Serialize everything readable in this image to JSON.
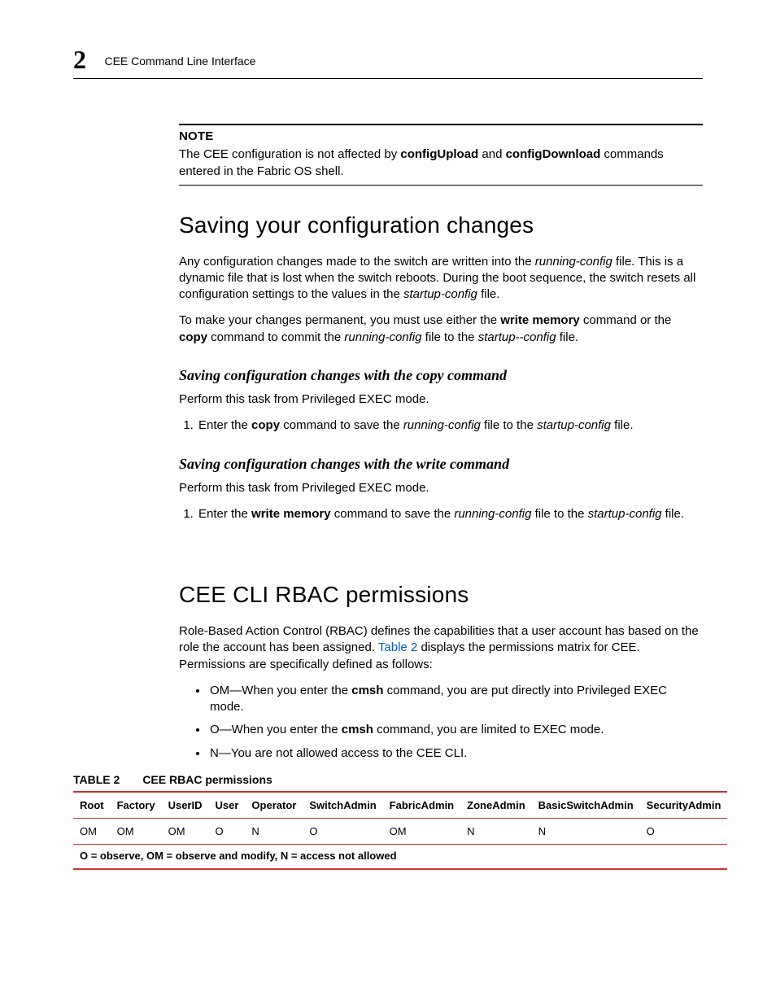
{
  "header": {
    "chapter_number": "2",
    "running_title": "CEE Command Line Interface"
  },
  "note": {
    "label": "NOTE",
    "pre": "The CEE configuration is not affected by ",
    "cmd1": "configUpload",
    "mid": " and ",
    "cmd2": "configDownload",
    "post": " commands entered in the Fabric OS shell."
  },
  "section1": {
    "title": "Saving your configuration changes",
    "p1a": "Any configuration changes made to the switch are written into the ",
    "p1b": "running-config",
    "p1c": " file. This is a dynamic file that is lost when the switch reboots. During the boot sequence, the switch resets all configuration settings to the values in the ",
    "p1d": "startup-config",
    "p1e": " file.",
    "p2a": "To make your changes permanent, you must use either the ",
    "p2b": "write memory",
    "p2c": " command or the ",
    "p2d": "copy",
    "p2e": " command to commit the ",
    "p2f": "running-config",
    "p2g": " file to the ",
    "p2h": "startup--config",
    "p2i": " file.",
    "sub1": {
      "title": "Saving configuration changes with the copy command",
      "intro": "Perform this task from Privileged EXEC mode.",
      "s1a": "Enter the ",
      "s1b": "copy",
      "s1c": " command to save the ",
      "s1d": "running-config",
      "s1e": " file to the ",
      "s1f": "startup-config",
      "s1g": " file."
    },
    "sub2": {
      "title": "Saving configuration changes with the write command",
      "intro": "Perform this task from Privileged EXEC mode.",
      "s1a": "Enter the ",
      "s1b": "write memory",
      "s1c": " command to save the ",
      "s1d": "running-config",
      "s1e": " file to the ",
      "s1f": "startup-config",
      "s1g": " file."
    }
  },
  "section2": {
    "title": "CEE CLI RBAC permissions",
    "p1a": "Role-Based Action Control (RBAC) defines the capabilities that a user account has based on the role the account has been assigned. ",
    "p1link": "Table 2",
    "p1b": " displays the permissions matrix for CEE. Permissions are specifically defined as follows:",
    "b1a": "OM—When you enter the ",
    "b1b": "cmsh",
    "b1c": " command, you are put directly into Privileged EXEC mode.",
    "b2a": "O—When you enter the ",
    "b2b": "cmsh",
    "b2c": " command, you are limited to EXEC mode.",
    "b3": "N—You are not allowed access to the CEE CLI."
  },
  "table": {
    "label": "TABLE 2",
    "title": "CEE RBAC permissions",
    "headers": [
      "Root",
      "Factory",
      "UserID",
      "User",
      "Operator",
      "SwitchAdmin",
      "FabricAdmin",
      "ZoneAdmin",
      "BasicSwitchAdmin",
      "SecurityAdmin"
    ],
    "row": [
      "OM",
      "OM",
      "OM",
      "O",
      "N",
      "O",
      "OM",
      "N",
      "N",
      "O"
    ],
    "legend": "O = observe, OM = observe and modify, N = access not allowed"
  }
}
